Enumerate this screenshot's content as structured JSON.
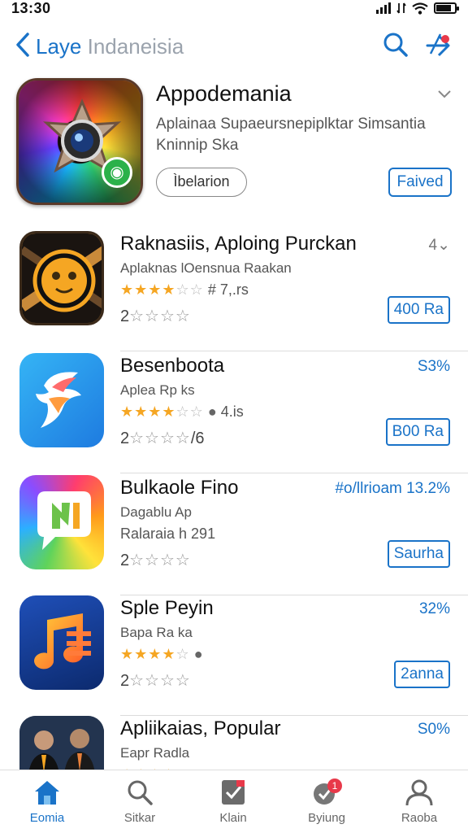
{
  "status": {
    "time": "13:30"
  },
  "nav": {
    "title": "Laye",
    "title_suffix": "Indaneisia"
  },
  "featured": {
    "title": "Appodemania",
    "subtitle": "Aplainaa Supaeursnepiplktar Simsantia Kninnip Ska",
    "button_label": "Ìbelarion",
    "saved_label": "Faived"
  },
  "apps": [
    {
      "title": "Raknasiis, Aploing Purckan",
      "developer": "Aplaknas lOensnua Raakan",
      "rating_stars": 4,
      "rating_text": "# 7,.rs",
      "rank": "2",
      "meta": "4⌄",
      "price": "400 Ra"
    },
    {
      "title": "Besenboota",
      "developer": "Aplea Rp ks",
      "rating_stars": 3.5,
      "rating_text": "4.is",
      "rank": "2",
      "rank_suffix": "/6",
      "meta": "S3%",
      "price": "B00 Ra"
    },
    {
      "title": "Bulkaole Fino",
      "developer": "Dagablu Ap",
      "developer2": "Ralaraia h 291",
      "rank": "2",
      "meta": "#o/llrioam 13.2%",
      "price": "Saurha"
    },
    {
      "title": "Sple Peyin",
      "developer": "Bapa Ra ka",
      "rating_stars": 4,
      "rank": "2",
      "meta": "32%",
      "price": "2anna"
    },
    {
      "title": "Apliikaias, Popular",
      "developer": "Eapr Radla",
      "meta": "S0%"
    }
  ],
  "tabs": [
    {
      "label": "Eomia",
      "icon": "home-icon",
      "active": true
    },
    {
      "label": "Sitkar",
      "icon": "search-icon",
      "active": false
    },
    {
      "label": "Klain",
      "icon": "checklist-icon",
      "active": false
    },
    {
      "label": "Byiung",
      "icon": "updates-icon",
      "active": false,
      "badge": "1"
    },
    {
      "label": "Raoba",
      "icon": "profile-icon",
      "active": false
    }
  ],
  "colors": {
    "accent": "#1a73c8",
    "star": "#f5a623"
  }
}
